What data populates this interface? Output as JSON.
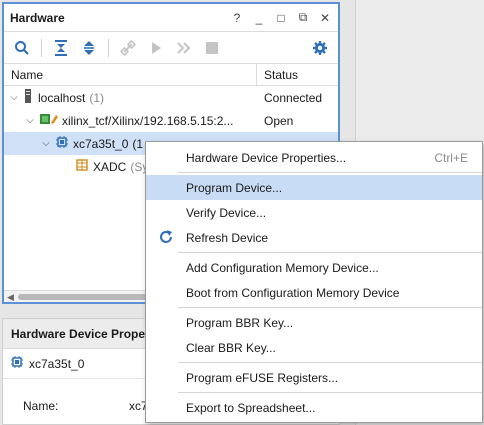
{
  "hardware": {
    "title": "Hardware",
    "controls": {
      "help": "?",
      "minimize": "_",
      "maximize": "□",
      "float": "⧉",
      "close": "✕"
    },
    "columns": {
      "name": "Name",
      "status": "Status"
    },
    "rows": [
      {
        "name": "localhost",
        "count": "(1)",
        "status": "Connected"
      },
      {
        "name": "xilinx_tcf/Xilinx/192.168.5.15:2...",
        "status": "Open"
      },
      {
        "name": "xc7a35t_0",
        "suffix": "(1",
        "status": ""
      },
      {
        "name": "XADC",
        "suffix": "(Sy",
        "status": ""
      }
    ]
  },
  "properties": {
    "title": "Hardware Device Prope",
    "device": "xc7a35t_0",
    "name_label": "Name:",
    "name_value": "xc7"
  },
  "context_menu": {
    "items": [
      {
        "label": "Hardware Device Properties...",
        "shortcut": "Ctrl+E"
      },
      {
        "label": "Program Device..."
      },
      {
        "label": "Verify Device..."
      },
      {
        "label": "Refresh Device"
      },
      {
        "label": "Add Configuration Memory Device..."
      },
      {
        "label": "Boot from Configuration Memory Device"
      },
      {
        "label": "Program BBR Key..."
      },
      {
        "label": "Clear BBR Key..."
      },
      {
        "label": "Program eFUSE Registers..."
      },
      {
        "label": "Export to Spreadsheet..."
      }
    ],
    "highlight_color": "#c8dcf5"
  },
  "colors": {
    "accent": "#5b8fd6",
    "selection": "#cfe0f7",
    "icon_blue": "#2f6fb8"
  }
}
